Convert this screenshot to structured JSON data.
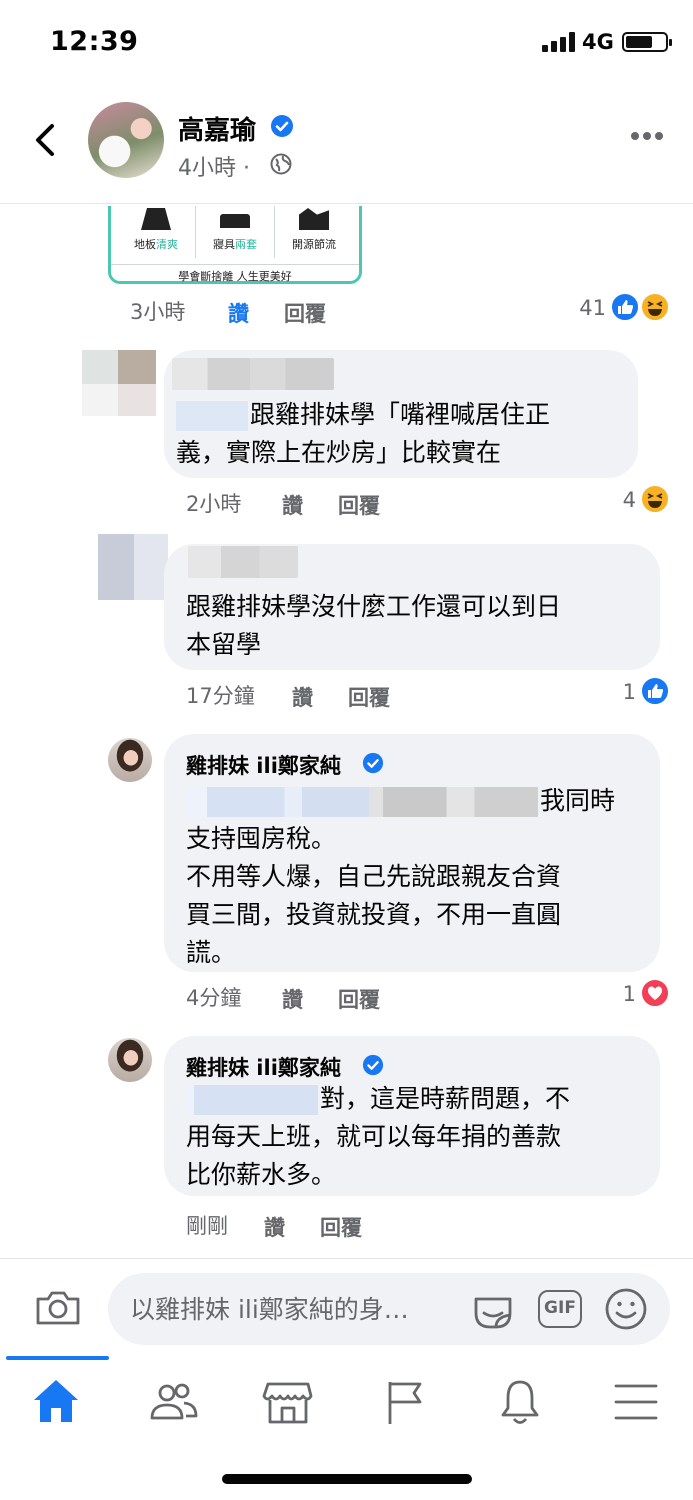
{
  "status_bar": {
    "time": "12:39",
    "network": "4G"
  },
  "post": {
    "author": "高嘉瑜",
    "time": "4小時",
    "separator": "·"
  },
  "shared_image": {
    "items": [
      {
        "pre": "地板",
        "highlight": "清爽"
      },
      {
        "pre": "寢具",
        "highlight": "兩套"
      },
      {
        "pre": "開源節流",
        "highlight": ""
      }
    ],
    "caption": "學會斷捨離 人生更美好"
  },
  "top_comment_actions": {
    "time": "3小時",
    "like": "讚",
    "reply": "回覆",
    "reaction_count": "41"
  },
  "comments": [
    {
      "text_line1": "跟雞排妹學「嘴裡喊居住正",
      "text_line2": "義，實際上在炒房」比較實在",
      "time": "2小時",
      "like": "讚",
      "reply": "回覆",
      "reaction_count": "4"
    },
    {
      "text_line1": "跟雞排妹學沒什麼工作還可以到日",
      "text_line2": "本留學",
      "time": "17分鐘",
      "like": "讚",
      "reply": "回覆",
      "reaction_count": "1"
    }
  ],
  "replies": [
    {
      "name": "雞排妹 ili鄭家純",
      "line1_tail": "我同時",
      "line2": "支持囤房稅。",
      "line3": "不用等人爆，自己先說跟親友合資",
      "line4": "買三間，投資就投資，不用一直圓",
      "line5": "謊。",
      "time": "4分鐘",
      "like": "讚",
      "reply": "回覆",
      "reaction_count": "1"
    },
    {
      "name": "雞排妹 ili鄭家純",
      "line1_tail": "對，這是時薪問題，不",
      "line2": "用每天上班，就可以每年捐的善款",
      "line3": "比你薪水多。",
      "time": "剛剛",
      "like": "讚",
      "reply": "回覆"
    }
  ],
  "composer": {
    "placeholder": "以雞排妹 ili鄭家純的身…",
    "gif_label": "GIF"
  },
  "icons": {
    "back": "chevron-left-icon",
    "verified": "verified-badge-icon",
    "globe": "globe-icon",
    "more": "more-icon",
    "like_reaction": "like-reaction-icon",
    "haha_reaction": "haha-reaction-icon",
    "love_reaction": "love-reaction-icon",
    "camera": "camera-icon",
    "sticker": "sticker-icon",
    "emoji": "emoji-icon",
    "home": "home-icon",
    "friends": "friends-icon",
    "marketplace": "marketplace-icon",
    "pages": "flag-icon",
    "notifications": "bell-icon",
    "menu": "menu-icon"
  },
  "colors": {
    "accent": "#1877f2",
    "love": "#f33e58",
    "haha": "#f7b125",
    "bubble": "#f0f2f5",
    "secondary_text": "#65676b"
  }
}
